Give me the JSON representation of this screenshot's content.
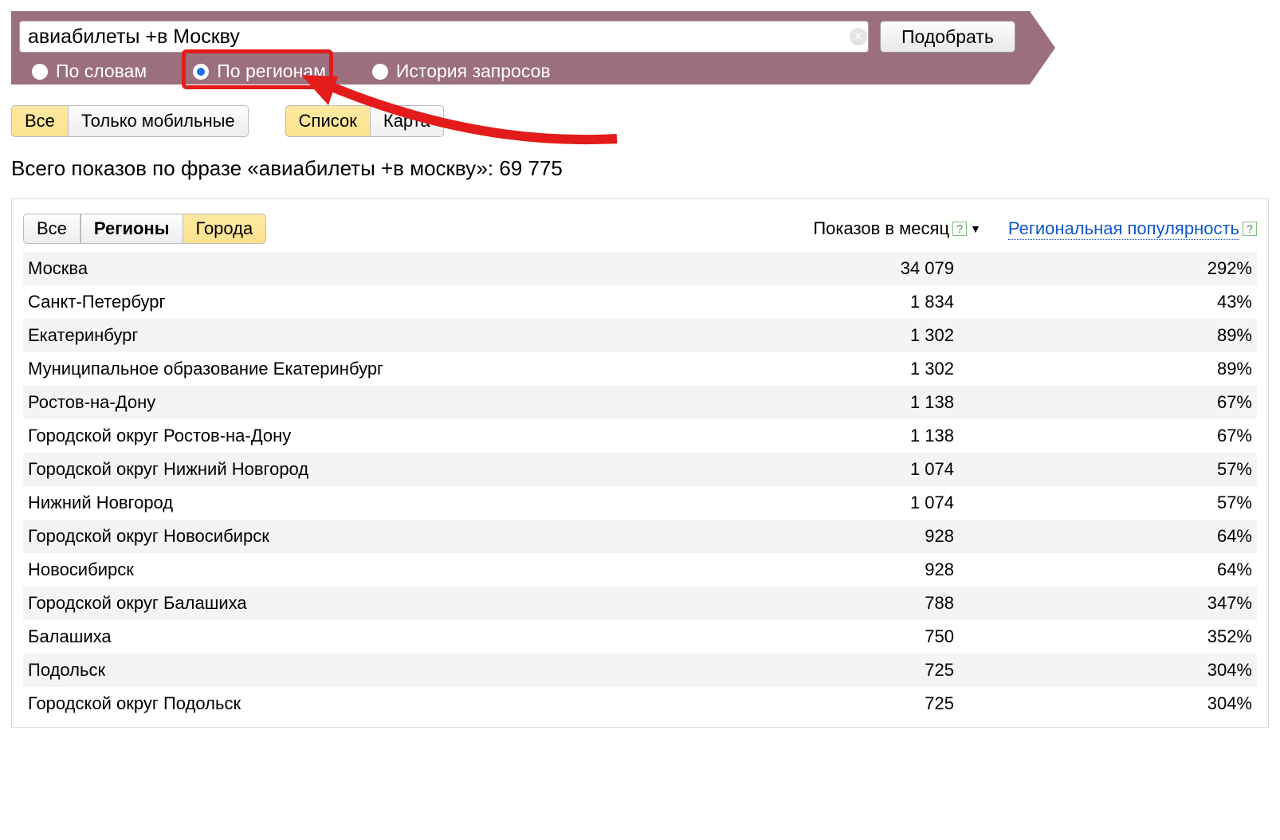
{
  "search": {
    "value": "авиабилеты +в Москву",
    "submit_label": "Подобрать"
  },
  "mode_tabs": {
    "by_words": "По словам",
    "by_regions": "По регионам",
    "history": "История запросов"
  },
  "device_filter": {
    "all": "Все",
    "mobile": "Только мобильные"
  },
  "view_filter": {
    "list": "Список",
    "map": "Карта"
  },
  "summary_text": "Всего показов по фразе «авиабилеты +в москву»: 69 775",
  "scope_tabs": {
    "all": "Все",
    "regions": "Регионы",
    "cities": "Города"
  },
  "columns": {
    "shows": "Показов в месяц",
    "popularity": "Региональная популярность"
  },
  "rows": [
    {
      "name": "Москва",
      "shows": "34 079",
      "pop": "292%"
    },
    {
      "name": "Санкт-Петербург",
      "shows": "1 834",
      "pop": "43%"
    },
    {
      "name": "Екатеринбург",
      "shows": "1 302",
      "pop": "89%"
    },
    {
      "name": "Муниципальное образование Екатеринбург",
      "shows": "1 302",
      "pop": "89%"
    },
    {
      "name": "Ростов-на-Дону",
      "shows": "1 138",
      "pop": "67%"
    },
    {
      "name": "Городской округ Ростов-на-Дону",
      "shows": "1 138",
      "pop": "67%"
    },
    {
      "name": "Городской округ Нижний Новгород",
      "shows": "1 074",
      "pop": "57%"
    },
    {
      "name": "Нижний Новгород",
      "shows": "1 074",
      "pop": "57%"
    },
    {
      "name": "Городской округ Новосибирск",
      "shows": "928",
      "pop": "64%"
    },
    {
      "name": "Новосибирск",
      "shows": "928",
      "pop": "64%"
    },
    {
      "name": "Городской округ Балашиха",
      "shows": "788",
      "pop": "347%"
    },
    {
      "name": "Балашиха",
      "shows": "750",
      "pop": "352%"
    },
    {
      "name": "Подольск",
      "shows": "725",
      "pop": "304%"
    },
    {
      "name": "Городской округ Подольск",
      "shows": "725",
      "pop": "304%"
    }
  ]
}
